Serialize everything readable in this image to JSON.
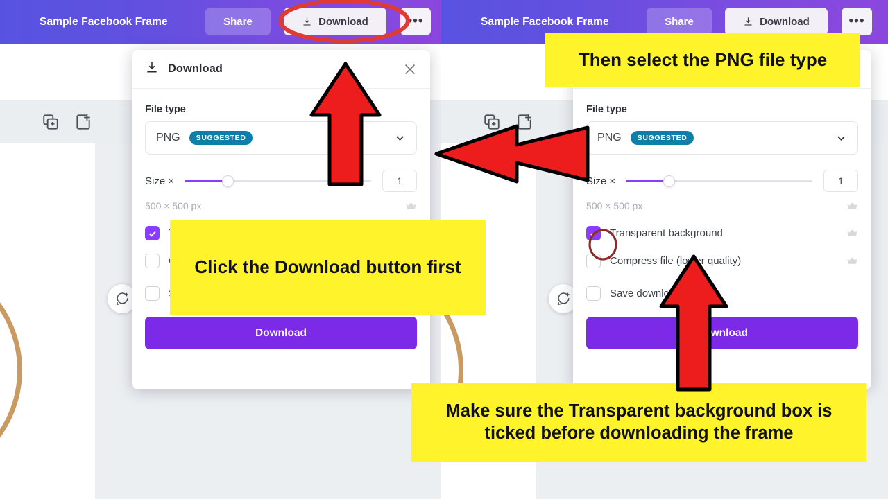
{
  "topbar": {
    "doc_title": "Sample Facebook Frame",
    "share_label": "Share",
    "download_label": "Download",
    "more_label": "•••",
    "download_icon": "download-tray-icon",
    "gradient_start": "#5753e0",
    "gradient_end": "#8b47dd"
  },
  "page_toolbar": {
    "duplicate_icon": "duplicate-page-icon",
    "add_page_icon": "add-page-icon",
    "comment_icon": "add-comment-icon"
  },
  "dialog": {
    "title": "Download",
    "title_icon": "download-tray-icon",
    "close_icon": "close-icon",
    "file_type_label": "File type",
    "file_type_value": "PNG",
    "file_type_badge": "SUGGESTED",
    "badge_color": "#0e7fa8",
    "dropdown_icon": "chevron-down-icon",
    "size_label": "Size ×",
    "size_value": "1",
    "size_slider_percent": 23,
    "dimensions": "500 × 500 px",
    "crown_icon": "crown-icon",
    "checkboxes": [
      {
        "label": "Transparent background",
        "checked": true,
        "pro": true
      },
      {
        "label": "Compress file (lower quality)",
        "checked": false,
        "pro": true
      },
      {
        "label": "Save download settings",
        "checked": false,
        "pro": false
      }
    ],
    "download_button": "Download",
    "accent_color": "#7d2ae8",
    "checkbox_checked_color": "#8b3dff"
  },
  "annotations": {
    "callout_1": "Click the Download button first",
    "callout_2": "Then select the PNG file type",
    "callout_3": "Make sure the Transparent background box is ticked before downloading the frame",
    "callout_bg": "#fff42b",
    "arrow_color": "#ee1d1d",
    "ellipse_color": "#e03b32",
    "circle_color": "#8e2b2b"
  }
}
